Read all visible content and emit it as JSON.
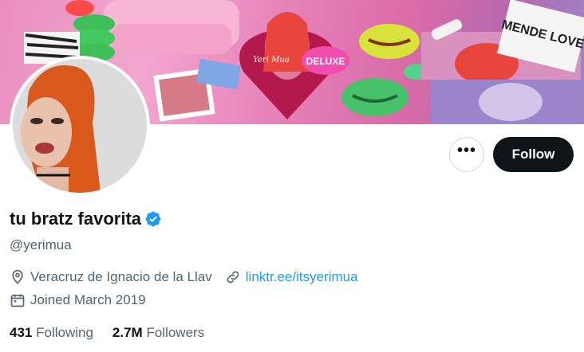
{
  "profile": {
    "display_name": "tu bratz favorita",
    "handle": "@yerimua",
    "location": "Veracruz de Ignacio de la Llav",
    "website": "linktr.ee/itsyerimua",
    "joined": "Joined March 2019",
    "verified": true
  },
  "actions": {
    "more_label": "•••",
    "follow_label": "Follow"
  },
  "stats": {
    "following_count": "431",
    "following_label": "Following",
    "followers_count": "2.7M",
    "followers_label": "Followers"
  },
  "banner": {
    "text_deluxe": "DELUXE",
    "text_yeri": "Yeri Mua",
    "text_poster": "MENDE LOVE"
  },
  "colors": {
    "follow_bg": "#0f1419",
    "link": "#1d9bf0",
    "secondary_text": "#536471",
    "verified": "#1d9bf0"
  }
}
